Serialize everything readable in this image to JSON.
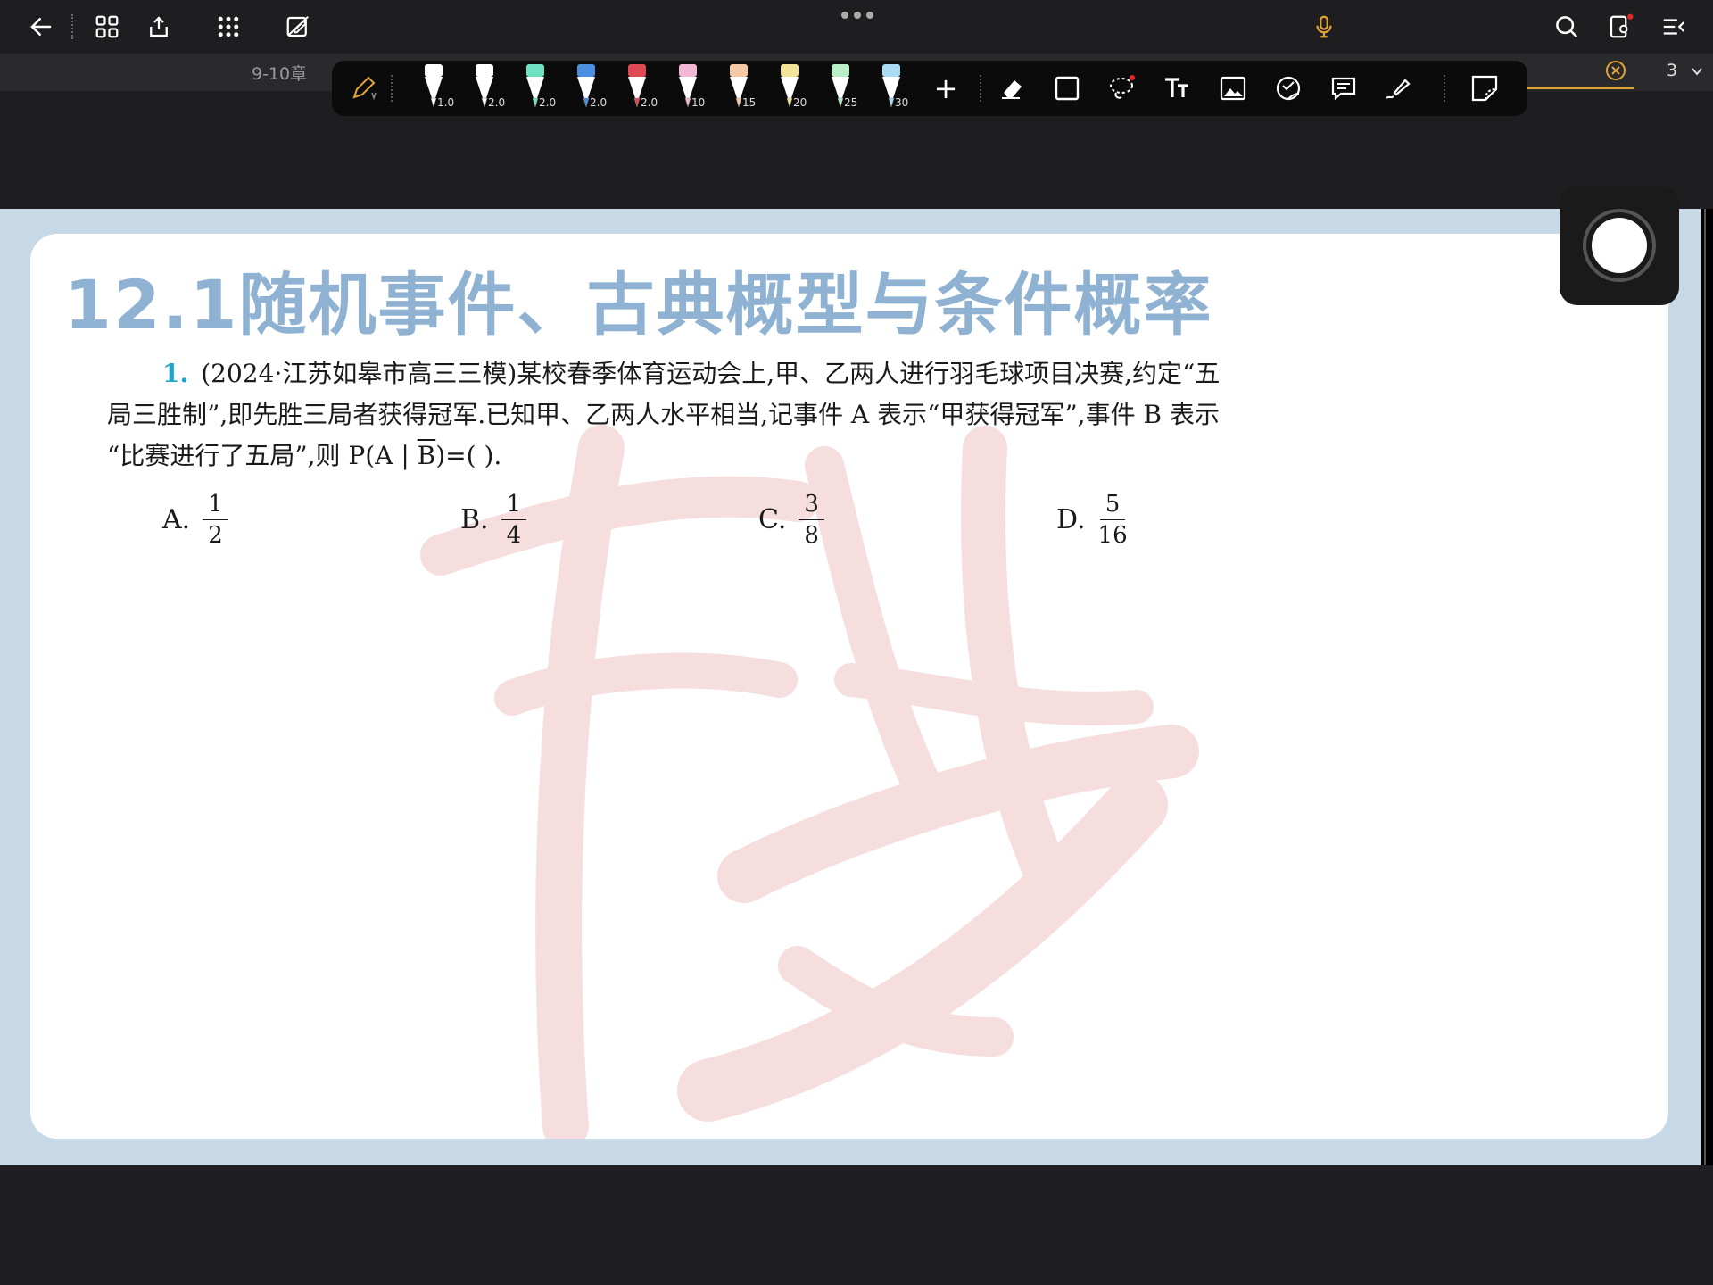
{
  "topbar": {
    "icons": [
      "back-arrow-icon",
      "grid-icon",
      "share-icon",
      "apps-icon",
      "edit-off-icon",
      "mic-icon",
      "search-icon",
      "settings-icon",
      "menu-icon"
    ]
  },
  "tab": {
    "title": "9-10章",
    "page_number": "3"
  },
  "pen_toolbar": {
    "pens": [
      {
        "size": "1.0",
        "color": "#ffffff"
      },
      {
        "size": "2.0",
        "color": "#ffffff"
      },
      {
        "size": "2.0",
        "color": "#6fe0c0"
      },
      {
        "size": "2.0",
        "color": "#4a8fe0"
      },
      {
        "size": "2.0",
        "color": "#e04a55"
      },
      {
        "size": "10",
        "color": "#f2b7d4"
      },
      {
        "size": "15",
        "color": "#f6c9a6"
      },
      {
        "size": "20",
        "color": "#f3e39a"
      },
      {
        "size": "25",
        "color": "#b9eec6"
      },
      {
        "size": "30",
        "color": "#a9dbf2"
      }
    ],
    "add_label": "+"
  },
  "document": {
    "heading": "12.1随机事件、古典概型与条件概率",
    "question": {
      "number": "1.",
      "line1": "(2024·江苏如皋市高三三模)某校春季体育运动会上,甲、乙两人进行羽毛球项目决赛,约定“五",
      "line2": "局三胜制”,即先胜三局者获得冠军.已知甲、乙两人水平相当,记事件 A 表示“甲获得冠军”,事件 B 表示",
      "line3_pre": "“比赛进行了五局”,则 P(A | ",
      "line3_bar": "B",
      "line3_post": ")=(      )."
    },
    "options": [
      {
        "letter": "A.",
        "num": "1",
        "den": "2"
      },
      {
        "letter": "B.",
        "num": "1",
        "den": "4"
      },
      {
        "letter": "C.",
        "num": "3",
        "den": "8"
      },
      {
        "letter": "D.",
        "num": "5",
        "den": "16"
      }
    ]
  },
  "colors": {
    "accent": "#e0a437",
    "heading": "#8fb2d2",
    "qnum": "#1fa3c7",
    "frame": "#c7d9e6"
  }
}
